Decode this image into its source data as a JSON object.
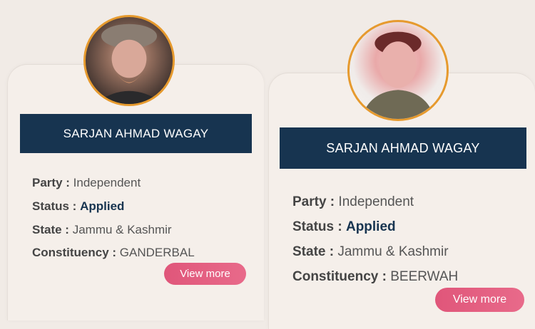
{
  "cards": [
    {
      "name": "SARJAN AHMAD WAGAY",
      "party_label": "Party :",
      "party": "Independent",
      "status_label": "Status :",
      "status": "Applied",
      "state_label": "State :",
      "state": "Jammu & Kashmir",
      "constituency_label": "Constituency :",
      "constituency": "GANDERBAL",
      "button_label": "View more"
    },
    {
      "name": "SARJAN AHMAD WAGAY",
      "party_label": "Party :",
      "party": "Independent",
      "status_label": "Status :",
      "status": "Applied",
      "state_label": "State :",
      "state": "Jammu & Kashmir",
      "constituency_label": "Constituency :",
      "constituency": "BEERWAH",
      "button_label": "View more"
    }
  ],
  "colors": {
    "banner": "#173450",
    "avatar_ring": "#e69a2e",
    "button": "#e0567a",
    "background": "#f1ebe6"
  }
}
